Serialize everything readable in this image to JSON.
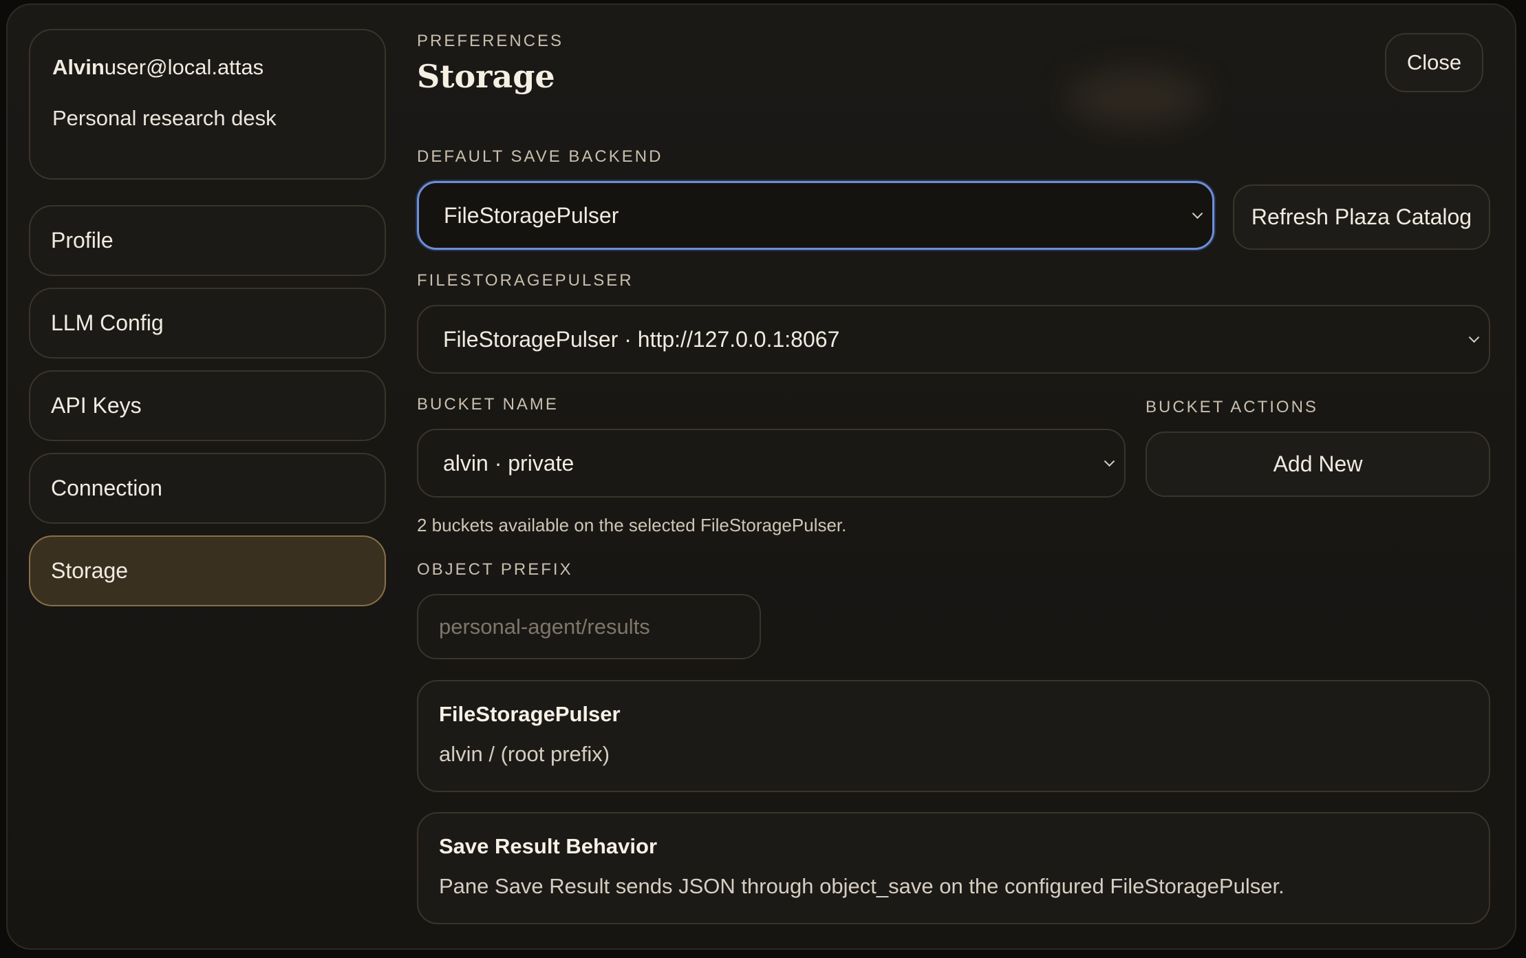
{
  "user": {
    "name": "Alvin",
    "email": "user@local.attas",
    "subtitle": "Personal research desk"
  },
  "sidebar": {
    "items": [
      {
        "label": "Profile",
        "active": false
      },
      {
        "label": "LLM Config",
        "active": false
      },
      {
        "label": "API Keys",
        "active": false
      },
      {
        "label": "Connection",
        "active": false
      },
      {
        "label": "Storage",
        "active": true
      }
    ]
  },
  "header": {
    "eyebrow": "PREFERENCES",
    "title": "Storage",
    "close_label": "Close"
  },
  "default_backend": {
    "label": "DEFAULT SAVE BACKEND",
    "selected": "FileStoragePulser",
    "refresh_label": "Refresh Plaza Catalog"
  },
  "pulser": {
    "label": "FILESTORAGEPULSER",
    "selected": "FileStoragePulser · http://127.0.0.1:8067"
  },
  "bucket": {
    "label": "BUCKET NAME",
    "selected": "alvin · private",
    "actions_label": "BUCKET ACTIONS",
    "add_label": "Add New",
    "hint": "2 buckets available on the selected FileStoragePulser."
  },
  "prefix": {
    "label": "OBJECT PREFIX",
    "value": "",
    "placeholder": "personal-agent/results"
  },
  "cards": [
    {
      "title": "FileStoragePulser",
      "body": "alvin / (root prefix)"
    },
    {
      "title": "Save Result Behavior",
      "body": "Pane Save Result sends JSON through object_save on the configured FileStoragePulser."
    }
  ],
  "colors": {
    "accent_focus": "#6e8fd6",
    "active_nav_bg": "#3a3020",
    "active_nav_border": "#8a7048"
  },
  "icons": {
    "dropdown": "chevron-down-icon"
  }
}
